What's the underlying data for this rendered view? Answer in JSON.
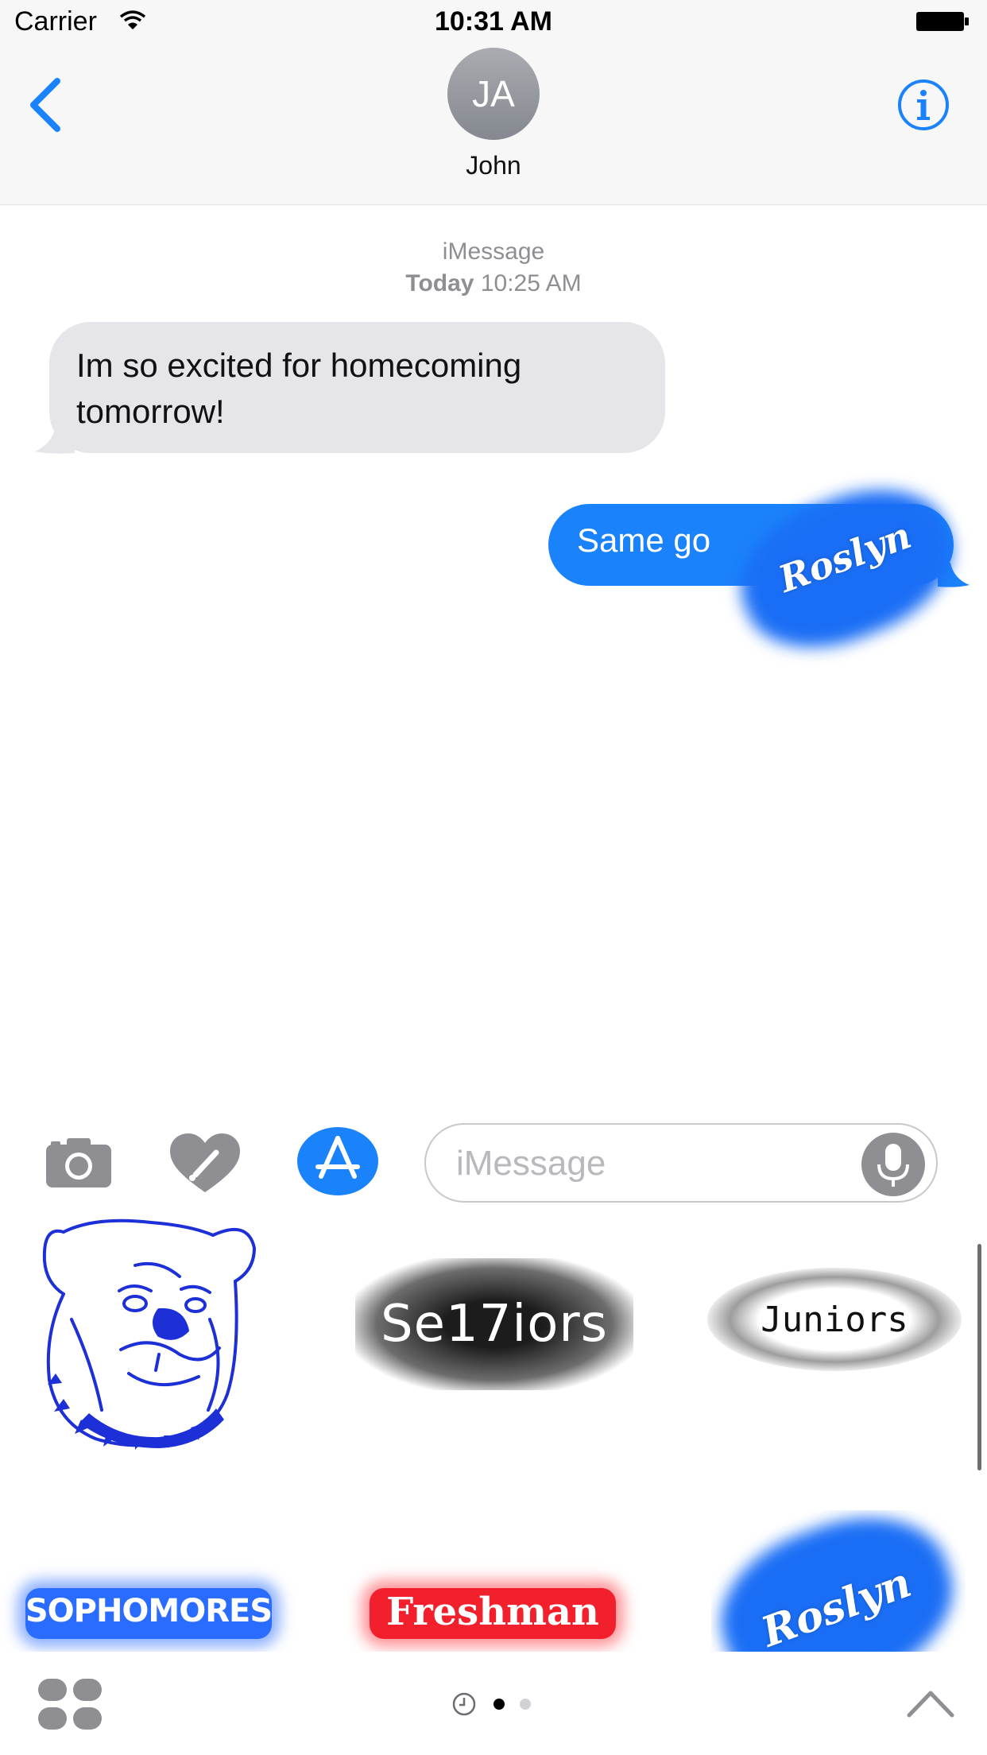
{
  "status_bar": {
    "carrier": "Carrier",
    "time": "10:31 AM"
  },
  "header": {
    "avatar_initials": "JA",
    "contact_name": "John",
    "back_icon": "chevron-left-icon",
    "info_icon": "info-icon"
  },
  "conversation": {
    "service": "iMessage",
    "date_day": "Today",
    "date_time": "10:25 AM",
    "messages": [
      {
        "direction": "incoming",
        "text": "Im so excited for homecoming tomorrow!"
      },
      {
        "direction": "outgoing",
        "text": "Same go",
        "sticker": "Roslyn"
      }
    ]
  },
  "input_bar": {
    "placeholder": "iMessage",
    "value": ""
  },
  "stickers": [
    {
      "name": "bulldog"
    },
    {
      "text": "Se17iors"
    },
    {
      "text": "Juniors"
    },
    {
      "text": "SOPHOMORES"
    },
    {
      "text": "Freshman"
    },
    {
      "text": "Roslyn"
    }
  ],
  "colors": {
    "accent": "#1a82fb",
    "incoming_bubble": "#e5e5ea",
    "sticker_blue": "#1a6ef5",
    "sticker_red": "#f21f2c"
  }
}
